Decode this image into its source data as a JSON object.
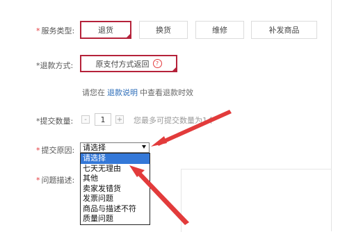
{
  "service_type": {
    "label": "服务类型:",
    "options": [
      "退货",
      "换货",
      "维修",
      "补发商品"
    ],
    "selected_index": 0
  },
  "refund_method": {
    "label": "*退款方式:",
    "value": "原支付方式返回",
    "help_icon": "question-circle-icon"
  },
  "refund_hint": {
    "prefix": "请您在",
    "link": "退款说明",
    "suffix": "中查看退款时效"
  },
  "quantity": {
    "label": "*提交数量:",
    "minus": "-",
    "value": "1",
    "plus": "+",
    "hint": "您最多可提交数量为1个"
  },
  "reason": {
    "label": "提交原因:",
    "selected": "请选择",
    "options": [
      "请选择",
      "七天无理由",
      "其他",
      "卖家发错货",
      "发票问题",
      "商品与描述不符",
      "质量问题"
    ],
    "highlighted_index": 0
  },
  "problem_desc": {
    "label": "问题描述:"
  },
  "colors": {
    "accent": "#b5223a",
    "required_star": "#e4393c",
    "link": "#2b6cb8",
    "highlight": "#3478d8",
    "arrow": "#e23b3b"
  }
}
